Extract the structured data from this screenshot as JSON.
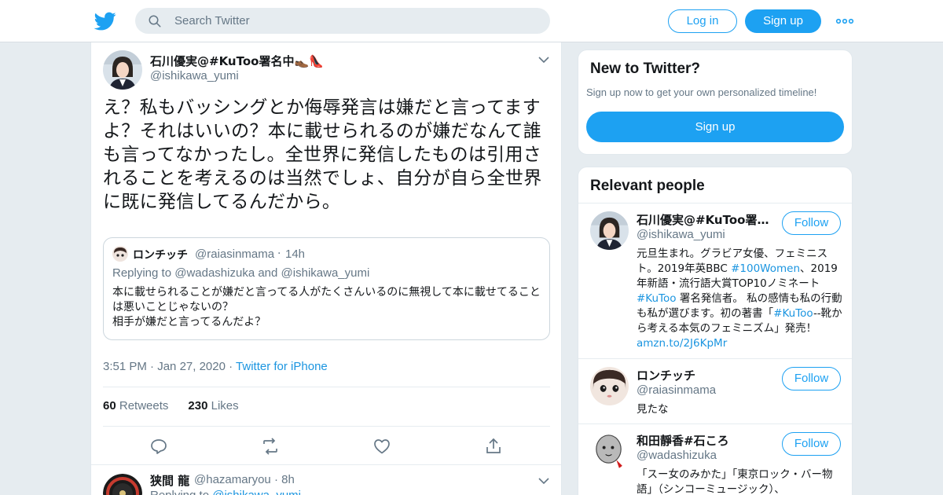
{
  "search": {
    "placeholder": "Search Twitter"
  },
  "header": {
    "login_label": "Log in",
    "signup_label": "Sign up"
  },
  "tweet": {
    "author_name": "石川優実@#KuToo署名中👞👠",
    "author_handle": "@ishikawa_yumi",
    "text": "え？私もバッシングとか侮辱発言は嫌だと言ってますよ？それはいいの？本に載せられるのが嫌だなんて誰も言ってなかったし。全世界に発信したものは引用されることを考えるのは当然でしょ、自分が自ら全世界に既に発信してるんだから。",
    "time": "3:51 PM",
    "date": "Jan 27, 2020",
    "source": "Twitter for iPhone",
    "retweets_count": "60",
    "retweets_label": "Retweets",
    "likes_count": "230",
    "likes_label": "Likes"
  },
  "quote": {
    "name": "ロンチッチ",
    "handle": "@raiasinmama",
    "time": "14h",
    "replying_prefix": "Replying to",
    "mention1": "@wadashizuka",
    "and": "and",
    "mention2": "@ishikawa_yumi",
    "text1": "本に載せられることが嫌だと言ってる人がたくさんいるのに無視して本に載せてることは悪いことじゃないの？",
    "text2": "相手が嫌だと言ってるんだよ？"
  },
  "reply_tweet": {
    "name": "狭間 龍",
    "handle": "@hazamaryou",
    "time": "8h",
    "replying_prefix": "Replying to",
    "mention": "@ishikawa_yumi"
  },
  "new_to_twitter": {
    "title": "New to Twitter?",
    "subtitle": "Sign up now to get your own personalized timeline!",
    "signup_label": "Sign up"
  },
  "relevant_people": {
    "title": "Relevant people",
    "follow_label": "Follow",
    "people": [
      {
        "name": "石川優実@#KuToo署名中👞👠",
        "handle": "@ishikawa_yumi",
        "bio": [
          {
            "t": "元旦生まれ。グラビア女優、フェミニスト。2019年英BBC "
          },
          {
            "t": "#100Women",
            "link": true
          },
          {
            "t": "、2019年新語・流行語大賞TOP10ノミネート "
          },
          {
            "t": "#KuToo",
            "link": true
          },
          {
            "t": " 署名発信者。 私の感情も私の行動も私が選びます。初の著書「"
          },
          {
            "t": "#KuToo",
            "link": true
          },
          {
            "t": "--靴から考える本気のフェミニズム」発売！"
          },
          {
            "t": "amzn.to/2J6KpMr",
            "link": true
          }
        ]
      },
      {
        "name": "ロンチッチ",
        "handle": "@raiasinmama",
        "bio": [
          {
            "t": "見たな"
          }
        ]
      },
      {
        "name": "和田靜香#石ころ",
        "handle": "@wadashizuka",
        "bio": [
          {
            "t": "「スー女のみかた」「東京ロック・バー物語」（シンコーミュージック）、"
          }
        ]
      }
    ]
  },
  "colors": {
    "accent": "#1da1f2",
    "link": "#1b95e0",
    "muted": "#657786",
    "background": "#e6ecf0"
  }
}
